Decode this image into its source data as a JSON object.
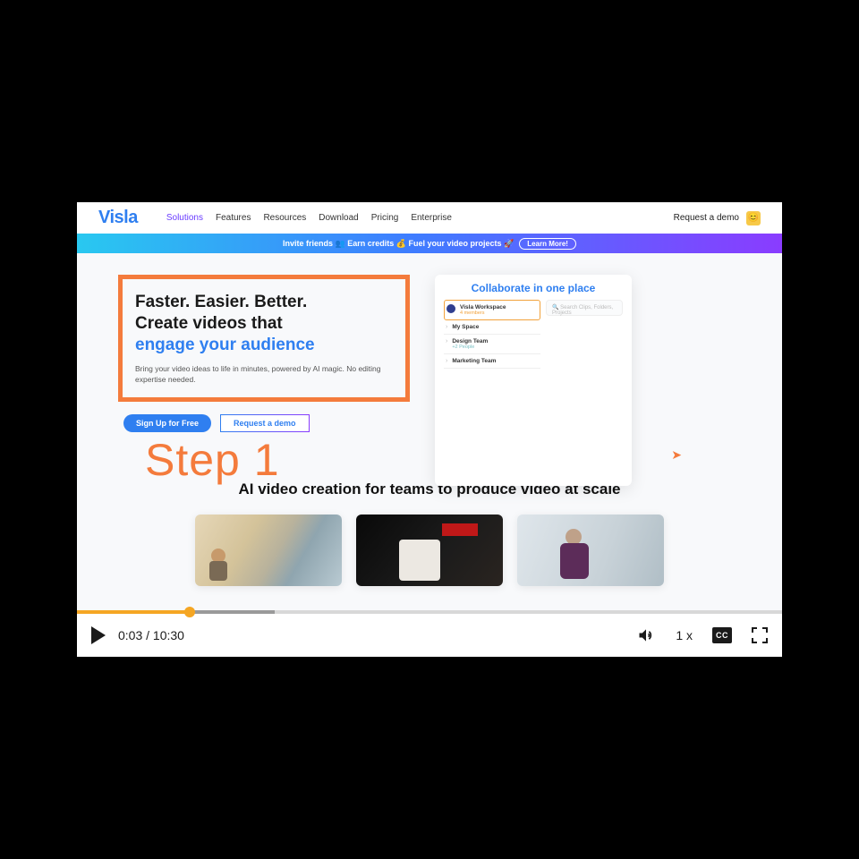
{
  "site": {
    "logo": "Visla",
    "nav": [
      "Solutions",
      "Features",
      "Resources",
      "Download",
      "Pricing",
      "Enterprise"
    ],
    "nav_active_index": 0,
    "request_demo": "Request a demo",
    "ribbon_text": "Invite friends 👥 Earn credits 💰 Fuel your video projects 🚀",
    "ribbon_cta": "Learn More!"
  },
  "hero": {
    "line1": "Faster. Easier. Better.",
    "line2": "Create videos that",
    "line3": "engage your audience",
    "sub": "Bring your video ideas to life in minutes, powered by AI magic. No editing expertise needed.",
    "cta_primary": "Sign Up for Free",
    "cta_secondary": "Request a demo"
  },
  "annotation": {
    "step_label": "Step 1"
  },
  "collab": {
    "title": "Collaborate in one place",
    "search_placeholder": "Search Clips, Folders, Projects",
    "items": [
      {
        "name": "Visla Workspace",
        "sub": "4 members"
      },
      {
        "name": "My Space",
        "sub": ""
      },
      {
        "name": "Design Team",
        "sub": "+2 People"
      },
      {
        "name": "Marketing Team",
        "sub": ""
      }
    ]
  },
  "section": {
    "title": "AI video creation for teams to produce video at scale"
  },
  "player": {
    "current_time": "0:03",
    "duration": "10:30",
    "speed": "1 x",
    "cc": "CC",
    "progress_pct": 16,
    "buffer_pct": 28
  }
}
